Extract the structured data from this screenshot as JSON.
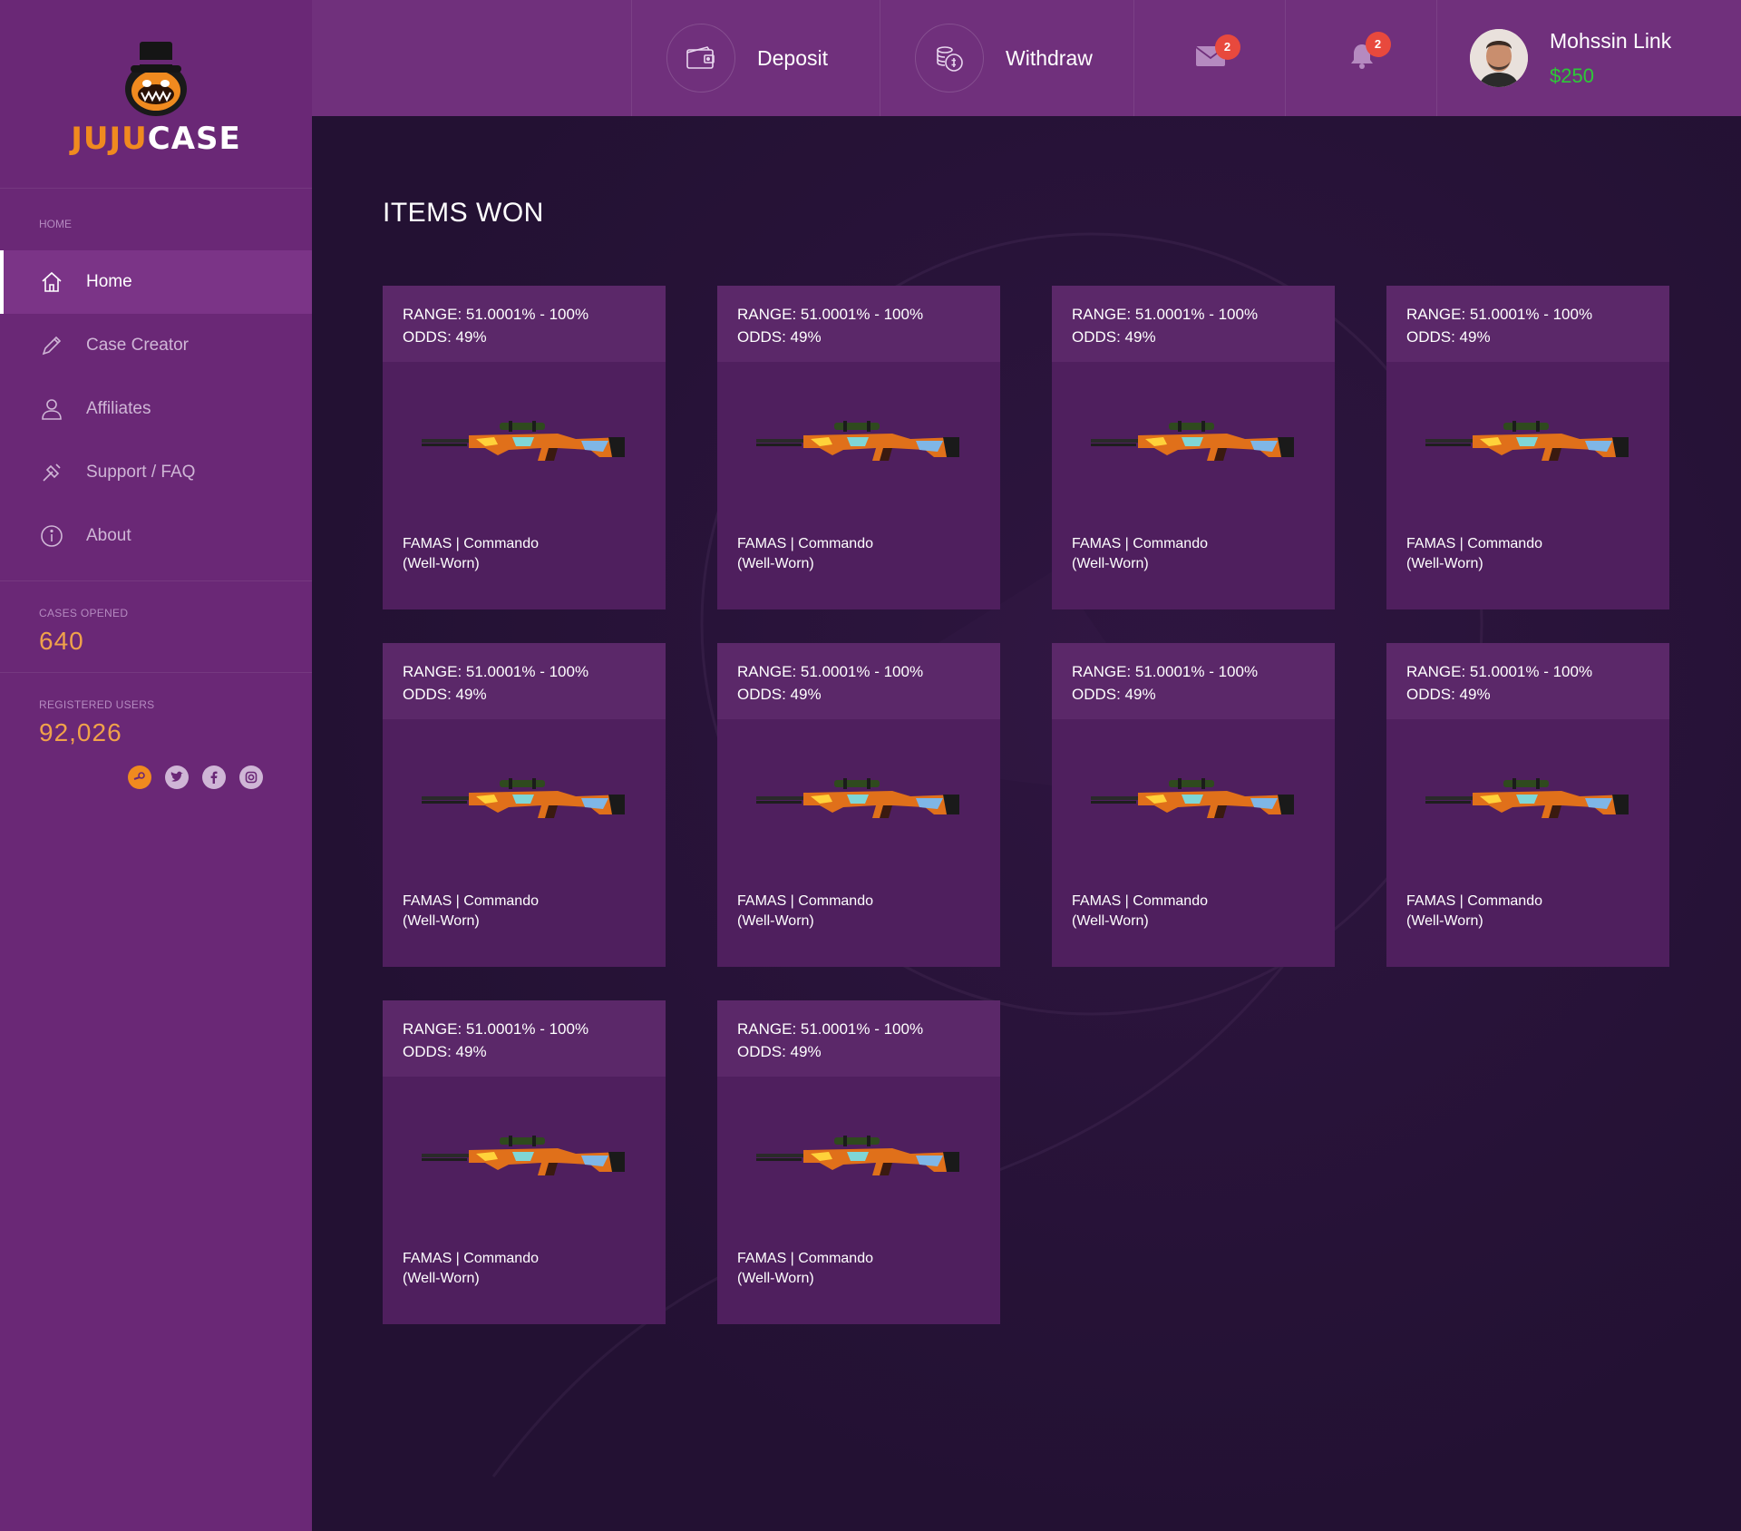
{
  "brand": {
    "part1": "JUJU",
    "part2": "CASE"
  },
  "sidebar": {
    "section_label": "HOME",
    "items": [
      {
        "label": "Home",
        "icon": "home-icon"
      },
      {
        "label": "Case Creator",
        "icon": "pencil-icon"
      },
      {
        "label": "Affiliates",
        "icon": "user-icon"
      },
      {
        "label": "Support / FAQ",
        "icon": "support-icon"
      },
      {
        "label": "About",
        "icon": "info-icon"
      }
    ],
    "stats": [
      {
        "label": "CASES OPENED",
        "value": "640"
      },
      {
        "label": "REGISTERED USERS",
        "value": "92,026"
      }
    ],
    "socials": [
      "steam-icon",
      "twitter-icon",
      "facebook-icon",
      "instagram-icon"
    ]
  },
  "header": {
    "deposit_label": "Deposit",
    "withdraw_label": "Withdraw",
    "messages_count": "2",
    "notifications_count": "2",
    "user_name": "Mohssin Link",
    "user_balance": "$250"
  },
  "main": {
    "title": "ITEMS WON",
    "items": [
      {
        "range": "RANGE: 51.0001% - 100%",
        "odds": "ODDS: 49%",
        "name": "FAMAS | Commando",
        "condition": "(Well-Worn)"
      },
      {
        "range": "RANGE: 51.0001% - 100%",
        "odds": "ODDS: 49%",
        "name": "FAMAS | Commando",
        "condition": "(Well-Worn)"
      },
      {
        "range": "RANGE: 51.0001% - 100%",
        "odds": "ODDS: 49%",
        "name": "FAMAS | Commando",
        "condition": "(Well-Worn)"
      },
      {
        "range": "RANGE: 51.0001% - 100%",
        "odds": "ODDS: 49%",
        "name": "FAMAS | Commando",
        "condition": "(Well-Worn)"
      },
      {
        "range": "RANGE: 51.0001% - 100%",
        "odds": "ODDS: 49%",
        "name": "FAMAS | Commando",
        "condition": "(Well-Worn)"
      },
      {
        "range": "RANGE: 51.0001% - 100%",
        "odds": "ODDS: 49%",
        "name": "FAMAS | Commando",
        "condition": "(Well-Worn)"
      },
      {
        "range": "RANGE: 51.0001% - 100%",
        "odds": "ODDS: 49%",
        "name": "FAMAS | Commando",
        "condition": "(Well-Worn)"
      },
      {
        "range": "RANGE: 51.0001% - 100%",
        "odds": "ODDS: 49%",
        "name": "FAMAS | Commando",
        "condition": "(Well-Worn)"
      },
      {
        "range": "RANGE: 51.0001% - 100%",
        "odds": "ODDS: 49%",
        "name": "FAMAS | Commando",
        "condition": "(Well-Worn)"
      },
      {
        "range": "RANGE: 51.0001% - 100%",
        "odds": "ODDS: 49%",
        "name": "FAMAS | Commando",
        "condition": "(Well-Worn)"
      }
    ]
  },
  "colors": {
    "sidebar_bg": "#6a2876",
    "topbar_bg": "#70307c",
    "main_bg": "#231133",
    "accent_orange": "#f0a24a",
    "balance_green": "#2dc937",
    "badge_red": "#e8493d"
  }
}
